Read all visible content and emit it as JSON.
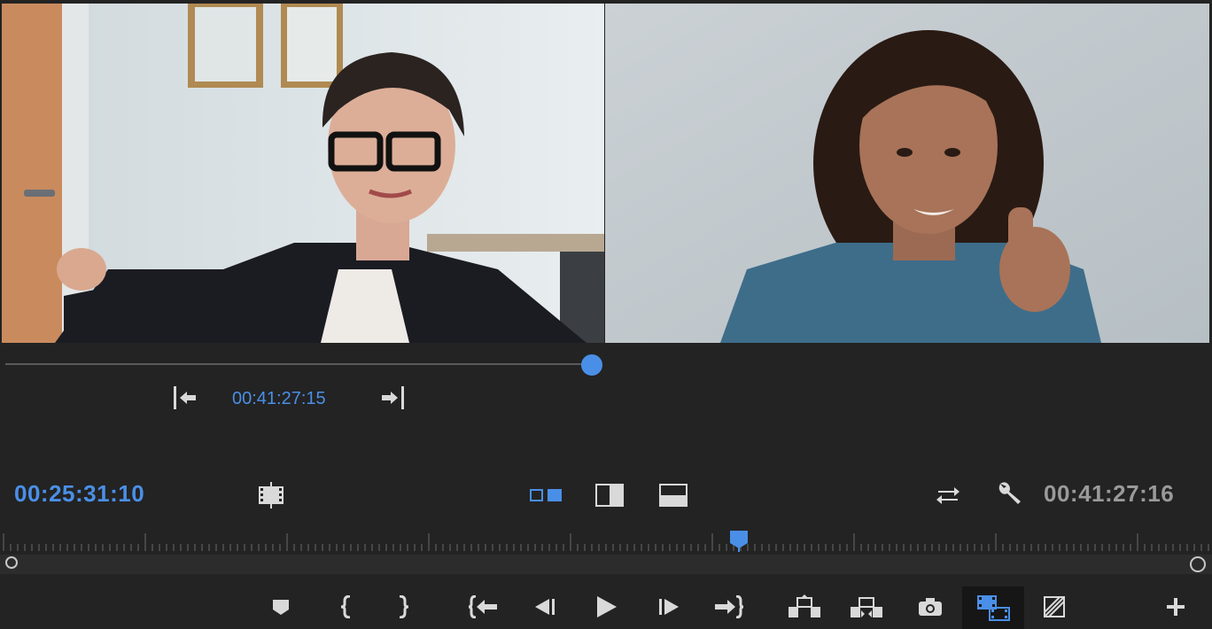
{
  "colors": {
    "background": "#232323",
    "accent": "#4a8fe7",
    "icon": "#d9d9d9",
    "timecode_right": "#9a9a9a",
    "ruler": "#6a6a6a"
  },
  "trim": {
    "in_icon": "go-to-in-arrow-icon",
    "out_icon": "go-to-out-arrow-icon",
    "timecode": "00:41:27:15",
    "scrubber_level_percent": 49
  },
  "monitor": {
    "current_timecode": "00:25:31:10",
    "duration_timecode": "00:41:27:16",
    "view_modes": [
      "side-by-side",
      "split-vertical",
      "split-horizontal"
    ],
    "active_view_mode": "side-by-side",
    "playhead_position_percent": 61
  },
  "transport": {
    "buttons": [
      {
        "name": "add-marker-button",
        "icon": "marker-icon"
      },
      {
        "name": "mark-in-button",
        "icon": "mark-in-bracket-icon"
      },
      {
        "name": "mark-out-button",
        "icon": "mark-out-bracket-icon"
      },
      {
        "name": "go-to-in-button",
        "icon": "go-to-in-icon"
      },
      {
        "name": "step-back-button",
        "icon": "step-back-icon"
      },
      {
        "name": "play-button",
        "icon": "play-icon"
      },
      {
        "name": "step-forward-button",
        "icon": "step-forward-icon"
      },
      {
        "name": "go-to-out-button",
        "icon": "go-to-out-icon"
      },
      {
        "name": "lift-button",
        "icon": "lift-icon"
      },
      {
        "name": "extract-button",
        "icon": "extract-icon"
      },
      {
        "name": "export-frame-button",
        "icon": "camera-icon"
      },
      {
        "name": "comparison-view-button",
        "icon": "comparison-view-icon"
      },
      {
        "name": "toggle-proxies-button",
        "icon": "proxy-toggle-icon"
      },
      {
        "name": "button-editor-button",
        "icon": "plus-icon"
      }
    ]
  }
}
